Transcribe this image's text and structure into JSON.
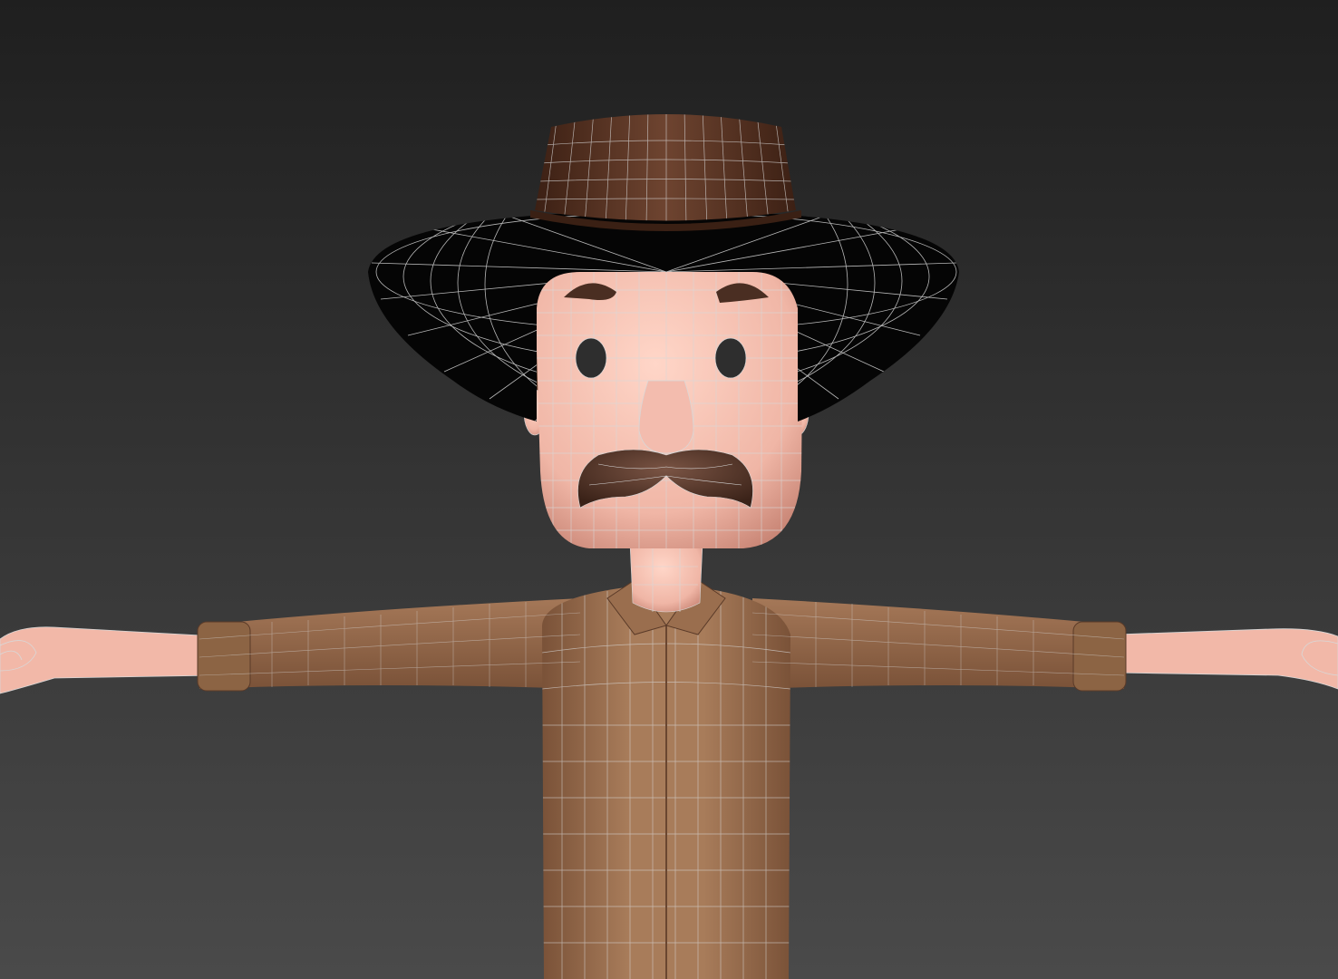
{
  "viewport": {
    "background_top": "#1f1f1f",
    "background_bottom": "#4a4a4a",
    "wireframe_color": "#d8d8d8"
  },
  "character": {
    "hat_crown_color": "#5a3322",
    "hat_brim_color": "#050505",
    "skin_color": "#f0b6a6",
    "hair_color": "#5a3a28",
    "mustache_color": "#4a2e22",
    "eye_color": "#2e2e2e",
    "shirt_color": "#9a6e4e",
    "cuff_color": "#8c6444"
  }
}
